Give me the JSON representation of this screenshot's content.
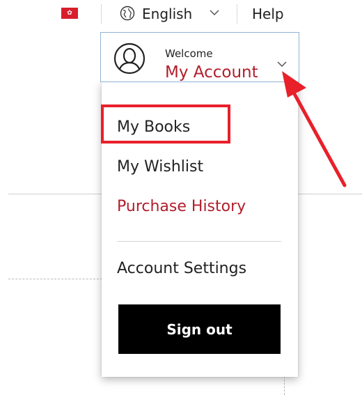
{
  "topbar": {
    "language_label": "English",
    "help_label": "Help",
    "region_flag": "hong-kong-flag",
    "language_icon": "globe-icon"
  },
  "account_menu": {
    "welcome_text": "Welcome",
    "account_label": "My Account",
    "expand_icon": "chevron-down-icon",
    "avatar_icon": "user-avatar-icon",
    "items": [
      {
        "label": "My Books",
        "highlighted": true
      },
      {
        "label": "My Wishlist"
      },
      {
        "label": "Purchase History"
      },
      {
        "label": "Account Settings"
      }
    ],
    "sign_out_label": "Sign out"
  },
  "colors": {
    "accent_red": "#b01e2b",
    "annotation_red": "#e8202a",
    "button_black": "#000000",
    "header_border": "#8fb3d6"
  }
}
